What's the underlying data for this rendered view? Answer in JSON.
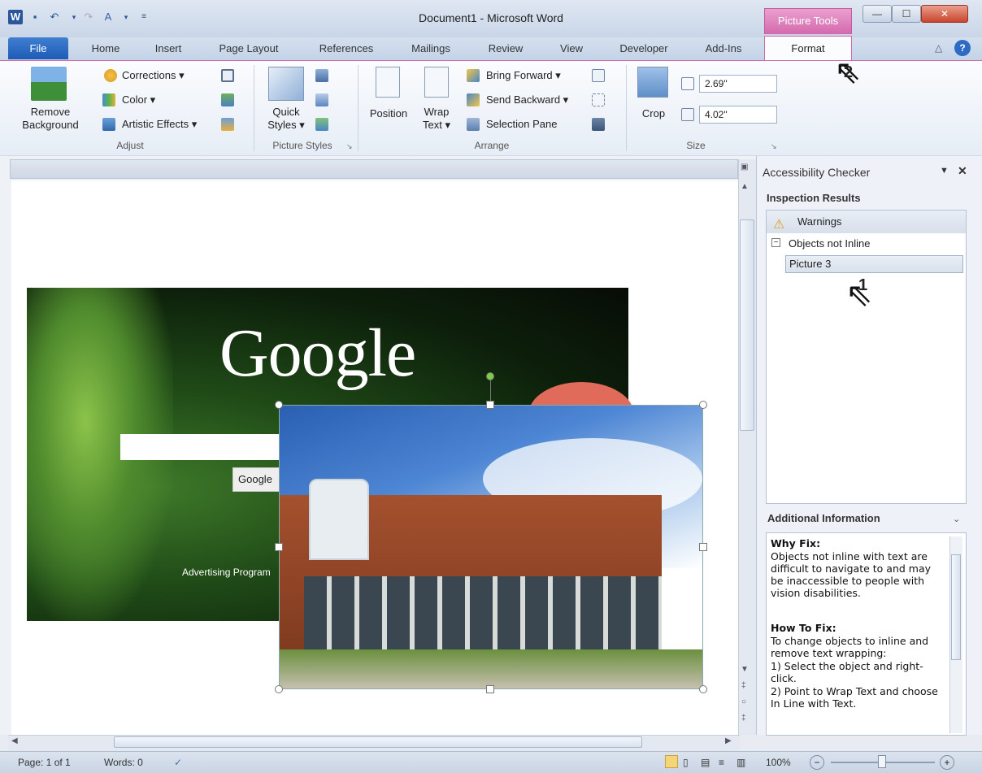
{
  "window": {
    "title": "Document1 - Microsoft Word",
    "context_tab_group": "Picture Tools"
  },
  "tabs": [
    "File",
    "Home",
    "Insert",
    "Page Layout",
    "References",
    "Mailings",
    "Review",
    "View",
    "Developer",
    "Add-Ins",
    "Format"
  ],
  "ribbon": {
    "adjust": {
      "label": "Adjust",
      "remove_background_1": "Remove",
      "remove_background_2": "Background",
      "corrections": "Corrections ▾",
      "color": "Color ▾",
      "artistic_effects": "Artistic Effects ▾"
    },
    "picture_styles": {
      "label": "Picture Styles",
      "quick_styles_1": "Quick",
      "quick_styles_2": "Styles ▾"
    },
    "arrange": {
      "label": "Arrange",
      "position": "Position",
      "wrap_text_1": "Wrap",
      "wrap_text_2": "Text ▾",
      "bring_forward": "Bring Forward ▾",
      "send_backward": "Send Backward ▾",
      "selection_pane": "Selection Pane"
    },
    "size": {
      "label": "Size",
      "crop": "Crop",
      "height": "2.69\"",
      "width": "4.02\""
    }
  },
  "document": {
    "google_logo": "Google",
    "google_button": "Google",
    "google_footer": "Advertising Program"
  },
  "pane": {
    "title": "Accessibility Checker",
    "inspection_results": "Inspection Results",
    "warnings": "Warnings",
    "category": "Objects not Inline",
    "item": "Picture 3",
    "additional_information": "Additional Information",
    "why_fix_heading": "Why Fix:",
    "why_fix_text": "Objects not inline with text are difficult to navigate to and may be inaccessible to people with vision disabilities.",
    "how_to_fix_heading": "How To Fix:",
    "how_to_fix_text": "To change objects to inline and remove text wrapping:",
    "step1": "1) Select the object and right-click.",
    "step2": "2) Point to Wrap Text and choose In Line with Text."
  },
  "callouts": {
    "one": "1",
    "two": "2"
  },
  "status": {
    "page": "Page: 1 of 1",
    "words": "Words: 0",
    "zoom": "100%"
  },
  "colors": {
    "accent_pink": "#d469ad",
    "file_blue": "#1f5bb5",
    "ribbon_bg": "#fbfcfe"
  }
}
